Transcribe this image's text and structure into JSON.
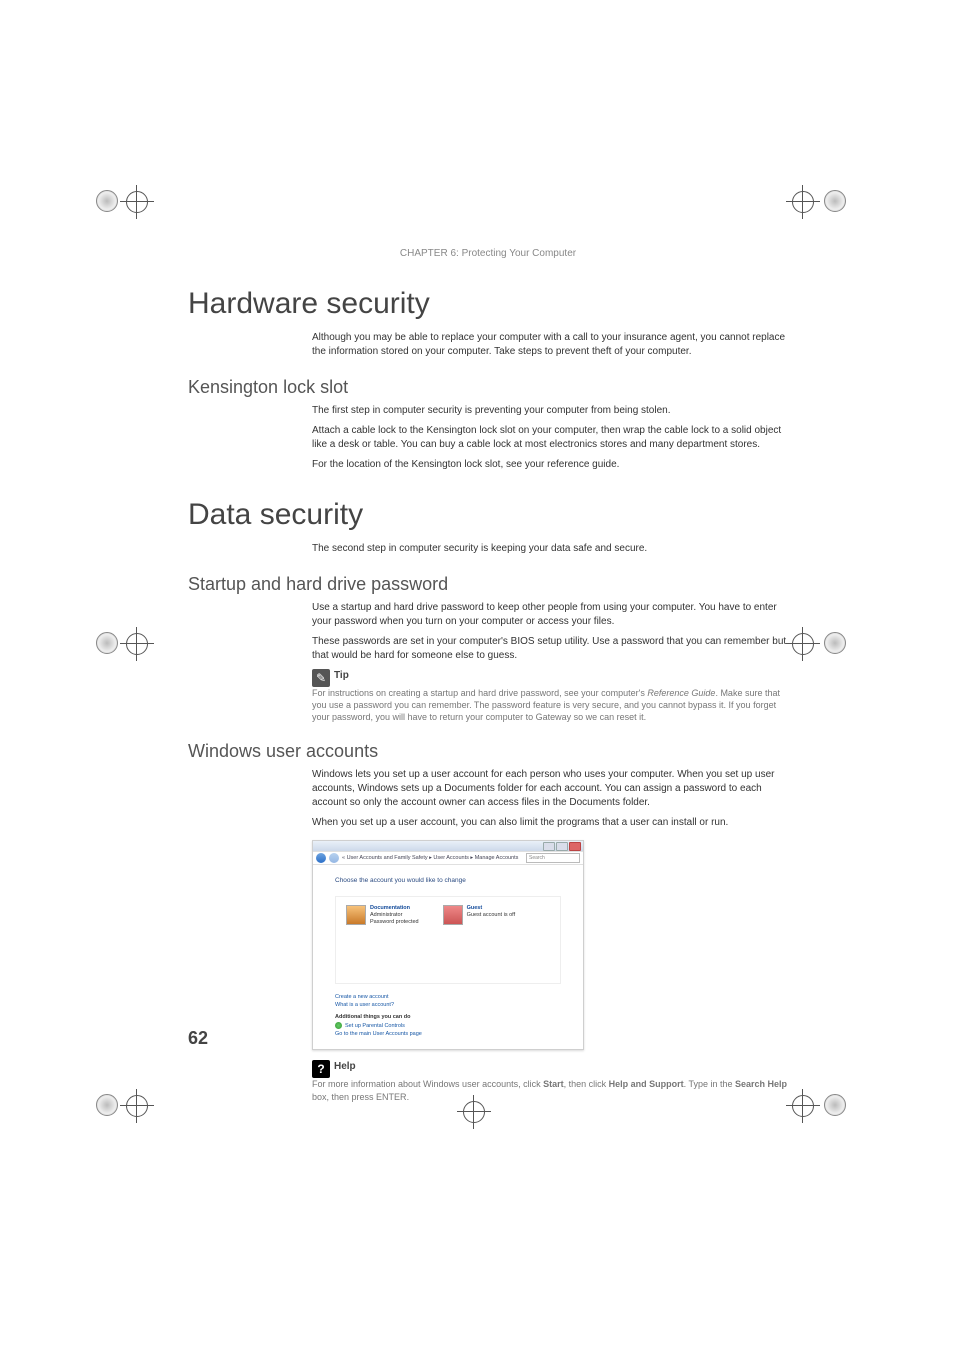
{
  "chapter_header": "CHAPTER 6: Protecting Your Computer",
  "page_number": "62",
  "h1_hardware": "Hardware security",
  "hardware_intro": "Although you may be able to replace your computer with a call to your insurance agent, you cannot replace the information stored on your computer. Take steps to prevent theft of your computer.",
  "h2_kensington": "Kensington lock slot",
  "kensington_p1": "The first step in computer security is preventing your computer from being stolen.",
  "kensington_p2": "Attach a cable lock to the Kensington lock slot on your computer, then wrap the cable lock to a solid object like a desk or table. You can buy a cable lock at most electronics stores and many department stores.",
  "kensington_p3": "For the location of the Kensington lock slot, see your reference guide.",
  "h1_data": "Data security",
  "data_intro": "The second step in computer security is keeping your data safe and secure.",
  "h2_startup": "Startup and hard drive password",
  "startup_p1": "Use a startup and hard drive password to keep other people from using your computer. You have to enter your password when you turn on your computer or access your files.",
  "startup_p2": "These passwords are set in your computer's BIOS setup utility. Use a password that you can remember but that would be hard for someone else to guess.",
  "tip": {
    "title": "Tip",
    "body_pre": "For instructions on creating a startup and hard drive password, see your computer's ",
    "body_em": "Reference Guide",
    "body_post": ". Make sure that you use a password you can remember. The password feature is very secure, and you cannot bypass it. If you forget your password, you will have to return your computer to Gateway so we can reset it."
  },
  "h2_windows": "Windows user accounts",
  "windows_p1": "Windows lets you set up a user account for each person who uses your computer. When you set up user accounts, Windows sets up a Documents folder for each account. You can assign a password to each account so only the account owner can access files in the Documents folder.",
  "windows_p2": "When you set up a user account, you can also limit the programs that a user can install or run.",
  "help": {
    "title": "Help",
    "pre": "For more information about Windows user accounts, click ",
    "start": "Start",
    "mid1": ", then click ",
    "help_support": "Help and Support",
    "mid2": ". Type ",
    "mid3": " in the ",
    "search_help": "Search Help",
    "mid4": " box, then press ",
    "enter": "ENTER",
    "end": "."
  },
  "screenshot": {
    "breadcrumb": "« User Accounts and Family Safety  ▸  User Accounts  ▸  Manage Accounts",
    "search_placeholder": "Search",
    "instruction": "Choose the account you would like to change",
    "acct1": {
      "name": "Documentation",
      "role": "Administrator",
      "status": "Password protected"
    },
    "acct2": {
      "name": "Guest",
      "status": "Guest account is off"
    },
    "link_create": "Create a new account",
    "link_whatis": "What is a user account?",
    "group_title": "Additional things you can do",
    "link_parental": "Set up Parental Controls",
    "link_main": "Go to the main User Accounts page"
  }
}
